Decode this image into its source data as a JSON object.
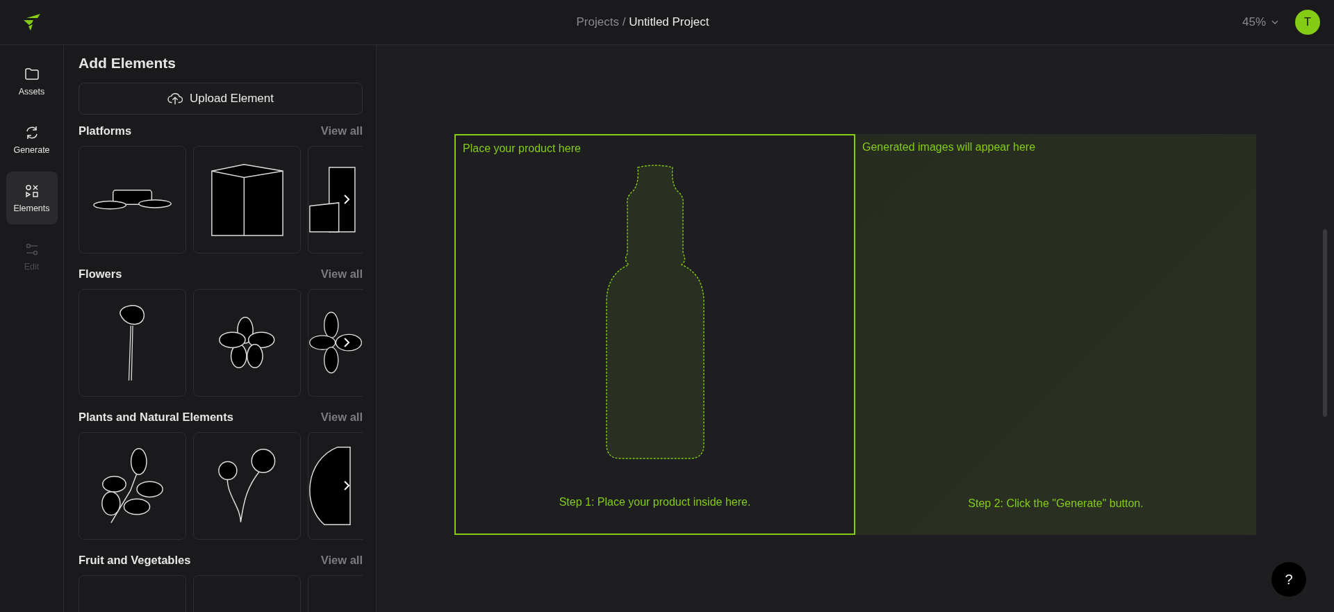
{
  "header": {
    "breadcrumb_parent": "Projects",
    "breadcrumb_separator": "/",
    "project_title": "Untitled Project",
    "zoom": "45%",
    "avatar_initial": "T"
  },
  "nav": [
    {
      "label": "Assets",
      "selected": false,
      "disabled": false
    },
    {
      "label": "Generate",
      "selected": false,
      "disabled": false
    },
    {
      "label": "Elements",
      "selected": true,
      "disabled": false
    },
    {
      "label": "Edit",
      "selected": false,
      "disabled": true
    }
  ],
  "panel": {
    "title": "Add Elements",
    "upload_button": "Upload Element",
    "sections": [
      {
        "title": "Platforms",
        "view_all": "View all"
      },
      {
        "title": "Flowers",
        "view_all": "View all"
      },
      {
        "title": "Plants and Natural Elements",
        "view_all": "View all"
      },
      {
        "title": "Fruit and Vegetables",
        "view_all": "View all"
      }
    ]
  },
  "canvas": {
    "product_frame": {
      "label": "Place your product here",
      "step": "Step 1: Place your product inside here."
    },
    "output_frame": {
      "label": "Generated images will appear here",
      "step": "Step 2: Click the \"Generate\" button."
    }
  },
  "help_button": "?"
}
